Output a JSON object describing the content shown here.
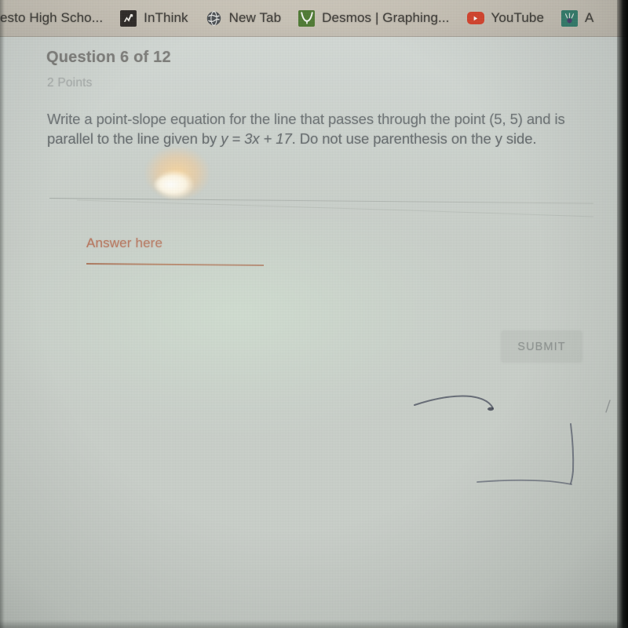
{
  "browser": {
    "bookmarks_bar": {
      "name": "bookmarks-bar",
      "items": [
        {
          "label": "esto High Scho...",
          "icon": "none",
          "truncated_left": true
        },
        {
          "label": "InThink",
          "icon": "inthink-icon"
        },
        {
          "label": "New Tab",
          "icon": "globe-icon"
        },
        {
          "label": "Desmos | Graphing...",
          "icon": "desmos-icon"
        },
        {
          "label": "YouTube",
          "icon": "youtube-icon"
        },
        {
          "label": "A",
          "icon": "app-icon",
          "truncated_right": true
        }
      ]
    }
  },
  "quiz": {
    "title": "Question 6 of 12",
    "points": "2 Points",
    "question_text": "Write a point-slope equation for the line that passes through the point (5, 5) and is parallel to the line given by ",
    "equation": "y = 3x + 17",
    "question_text_end": ". Do not use parenthesis on the y side.",
    "answer": {
      "placeholder": "Answer here",
      "value": ""
    },
    "submit_label": "SUBMIT"
  },
  "colors": {
    "page_background": "#ccd1cb",
    "bookmarks_bar": "#c8c2b6",
    "title_text": "#3a3632",
    "points_text": "#8d9290",
    "question_text": "#44494c",
    "answer_accent": "#b3664c",
    "answer_underline": "#a8644a",
    "submit_background": "#c0c6c0",
    "submit_text": "#8e9491",
    "divider": "#a9afa9",
    "glare_warm": "#ffd696",
    "glare_core": "#fffffc"
  }
}
